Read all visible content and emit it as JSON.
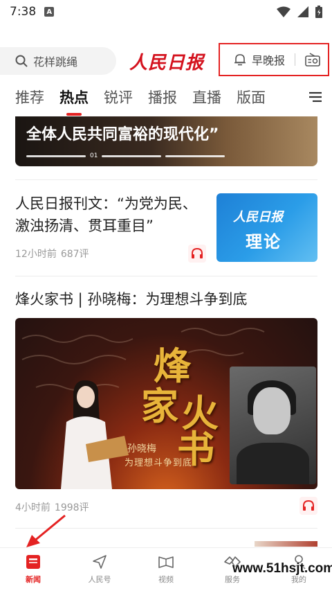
{
  "status_bar": {
    "time": "7:38",
    "notification_letter": "A"
  },
  "header": {
    "search_placeholder": "花样跳绳",
    "logo_text": "人民日报",
    "morning_evening_label": "早晚报"
  },
  "tabs": [
    {
      "label": "推荐",
      "active": false
    },
    {
      "label": "热点",
      "active": true
    },
    {
      "label": "锐评",
      "active": false
    },
    {
      "label": "播报",
      "active": false
    },
    {
      "label": "直播",
      "active": false
    },
    {
      "label": "版面",
      "active": false
    }
  ],
  "banner": {
    "title": "全体人民共同富裕的现代化”",
    "page_number": "01"
  },
  "articles": [
    {
      "title": "人民日报刊文：“为党为民、激浊扬清、贯耳重目”",
      "time": "12小时前",
      "comments": "687评",
      "thumb_line1": "人民日报",
      "thumb_line2": "理论"
    },
    {
      "title": "烽火家书 | 孙晓梅：为理想斗争到底",
      "time": "4小时前",
      "comments": "1998评",
      "image_calligraphy": [
        "烽",
        "火",
        "家",
        "书"
      ],
      "image_name": "孙晓梅",
      "image_subtitle": "为理想斗争到底"
    }
  ],
  "bottom_nav": [
    {
      "label": "新闻",
      "active": true
    },
    {
      "label": "人民号",
      "active": false
    },
    {
      "label": "视频",
      "active": false
    },
    {
      "label": "服务",
      "active": false
    },
    {
      "label": "我的",
      "active": false
    }
  ],
  "watermark": "www.51hsjt.com",
  "colors": {
    "accent": "#e42222",
    "thumb_blue": "#2b9de8"
  }
}
